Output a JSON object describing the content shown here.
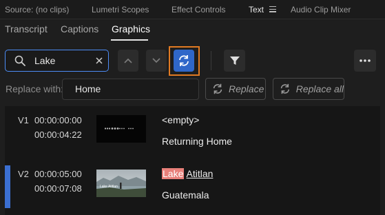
{
  "panel_tabs": [
    "Source: (no clips)",
    "Lumetri Scopes",
    "Effect Controls",
    "Text",
    "Audio Clip Mixer"
  ],
  "sub_tabs": [
    "Transcript",
    "Captions",
    "Graphics"
  ],
  "search": {
    "value": "Lake"
  },
  "replace": {
    "label": "Replace with:",
    "value": "Home",
    "replace_label": "Replace",
    "replace_all_label": "Replace all"
  },
  "results": [
    {
      "track": "V1",
      "start": "00:00:00:00",
      "end": "00:00:04:22",
      "title": "<empty>",
      "subtitle": "Returning Home"
    },
    {
      "track": "V2",
      "start": "00:00:05:00",
      "end": "00:00:07:08",
      "title_match": "Lake",
      "title_rest": "Atitlan",
      "subtitle": "Guatemala"
    }
  ],
  "thumb2_caption": "Lake Atitlan",
  "colors": {
    "accent_blue": "#2f67c9",
    "highlight_frame": "#e17a23",
    "match_highlight": "#e8807a"
  }
}
